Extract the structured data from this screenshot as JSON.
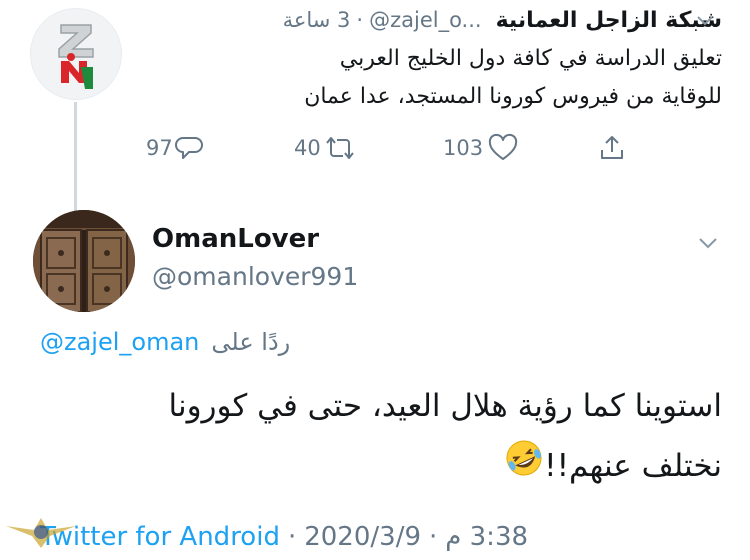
{
  "tweet1": {
    "name": "شبكة الزاجل العمانية",
    "handle": "@zajel_o...",
    "dot": "·",
    "time": "3 ساعة",
    "lines": [
      "تعليق الدراسة في كافة دول الخليج العربي",
      "للوقاية من فيروس كورونا المستجد، عدا عمان"
    ],
    "replies": "97",
    "retweets": "40",
    "likes": "103"
  },
  "tweet2": {
    "name": "OmanLover",
    "handle": "@omanlover991",
    "replying_label": "ردًا على",
    "replying_to": "@zajel_oman",
    "lines": [
      "استوينا كما رؤية هلال العيد، حتى في كورونا",
      "نختلف عنهم!!"
    ],
    "emoji": "rolling-on-floor-laughing",
    "source": "Twitter for Android",
    "date": "2020/3/9",
    "time": "3:38 م",
    "sep": "·"
  },
  "icons": {
    "reply": "reply-icon",
    "retweet": "retweet-icon",
    "like": "heart-icon",
    "share": "share-icon",
    "caret": "chevron-down-icon"
  },
  "colors": {
    "link": "#1da1f2",
    "secondary": "#657786",
    "text": "#14171a"
  }
}
